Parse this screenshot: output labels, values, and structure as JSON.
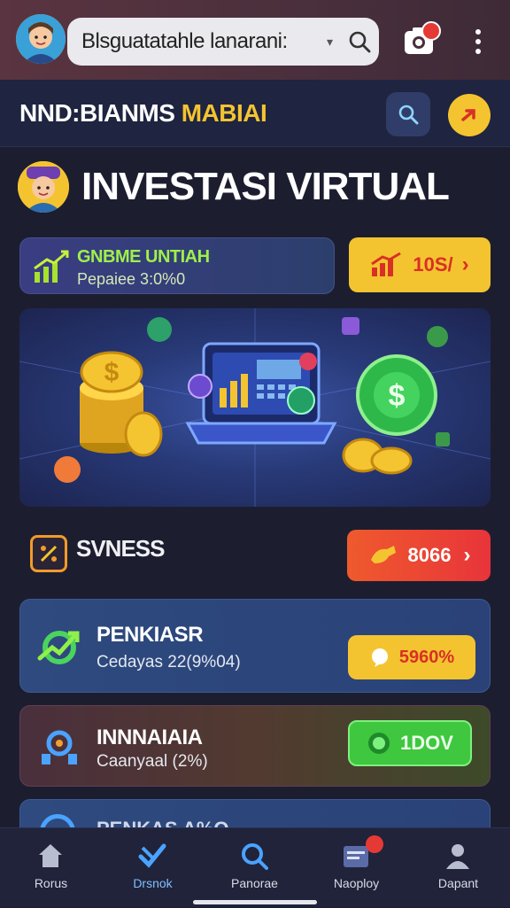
{
  "topbar": {
    "search_text": "Blsguatatahle lanarani:",
    "caret": "▾",
    "notification_badge": ""
  },
  "appbar": {
    "brand_part1": "NND:BIANMS",
    "brand_part2": "MABIAI"
  },
  "page": {
    "title": "INVESTASI VIRTUAL"
  },
  "stats_card": {
    "title": "GNBME UNTIAH",
    "subtitle": "Pepaiee 3:0%0",
    "action_label": "10S/",
    "action_arrow": "›"
  },
  "section": {
    "title": "SVNESS",
    "action_label": "8066",
    "action_arrow": "›"
  },
  "list": [
    {
      "title": "PENKIASR",
      "subtitle": "Cedayas 22(9%04)",
      "action_label": "5960%"
    },
    {
      "title": "INNNAIAIA",
      "subtitle": "Caanyaal (2%)",
      "action_label": "1DOV"
    },
    {
      "title": "PENKAS A%O",
      "subtitle": "",
      "action_label": ""
    }
  ],
  "nav": [
    {
      "label": "Rorus"
    },
    {
      "label": "Drsnok"
    },
    {
      "label": "Panorae"
    },
    {
      "label": "Naoploy"
    },
    {
      "label": "Dapant"
    }
  ],
  "colors": {
    "yellow": "#f4c430",
    "red": "#ef3b2d",
    "green": "#3fc73f",
    "accent_blue": "#4aa3ff"
  }
}
